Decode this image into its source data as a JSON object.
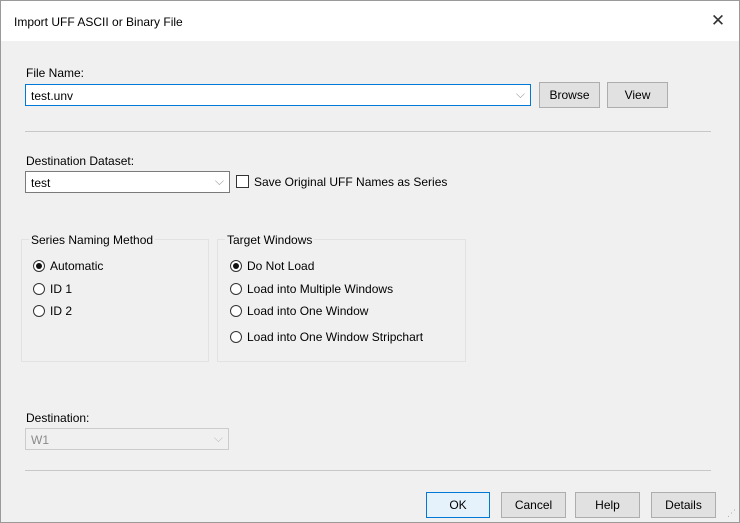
{
  "window": {
    "title": "Import UFF ASCII or Binary File",
    "close_glyph": "✕"
  },
  "file": {
    "label": "File Name:",
    "value": "test.unv",
    "browse_label": "Browse",
    "view_label": "View"
  },
  "dataset": {
    "label": "Destination Dataset:",
    "value": "test",
    "save_names_label": "Save Original UFF Names as Series",
    "save_names_checked": false
  },
  "naming": {
    "title": "Series Naming Method",
    "options": [
      {
        "label": "Automatic",
        "checked": true
      },
      {
        "label": "ID 1",
        "checked": false
      },
      {
        "label": "ID 2",
        "checked": false
      }
    ]
  },
  "target": {
    "title": "Target Windows",
    "options": [
      {
        "label": "Do Not Load",
        "checked": true
      },
      {
        "label": "Load into Multiple Windows",
        "checked": false
      },
      {
        "label": "Load into One Window",
        "checked": false
      },
      {
        "label": "Load into One Window Stripchart",
        "checked": false
      }
    ]
  },
  "destination": {
    "label": "Destination:",
    "value": "W1",
    "disabled": true
  },
  "buttons": {
    "ok": "OK",
    "cancel": "Cancel",
    "help": "Help",
    "details": "Details"
  },
  "icons": {
    "dropdown_arrow": "⌵",
    "resize_grip": "⋰"
  }
}
